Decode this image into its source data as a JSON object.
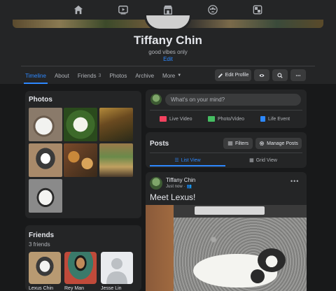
{
  "topnav": {
    "icons": [
      "home-icon",
      "watch-icon",
      "marketplace-icon",
      "groups-icon",
      "gaming-icon"
    ]
  },
  "profile": {
    "name": "Tiffany Chin",
    "bio": "good vibes only",
    "edit_link": "Edit"
  },
  "tabs": [
    {
      "label": "Timeline"
    },
    {
      "label": "About"
    },
    {
      "label": "Friends",
      "count": "3"
    },
    {
      "label": "Photos"
    },
    {
      "label": "Archive"
    },
    {
      "label": "More"
    }
  ],
  "header_buttons": {
    "edit_profile": "Edit Profile"
  },
  "photos_card": {
    "title": "Photos"
  },
  "friends_card": {
    "title": "Friends",
    "subtitle": "3 friends",
    "friends": [
      {
        "name": "Lexus Chin"
      },
      {
        "name": "Rey Man"
      },
      {
        "name": "Jesse Lin"
      }
    ]
  },
  "composer": {
    "placeholder": "What's on your mind?",
    "actions": [
      {
        "label": "Live Video",
        "color": "#f3425f"
      },
      {
        "label": "Photo/Video",
        "color": "#45bd62"
      },
      {
        "label": "Life Event",
        "color": "#2d88ff"
      }
    ]
  },
  "posts": {
    "title": "Posts",
    "filters_label": "Filters",
    "manage_label": "Manage Posts",
    "list_view_label": "List View",
    "grid_view_label": "Grid View"
  },
  "post": {
    "author": "Tiffany Chin",
    "time": "Just now",
    "text": "Meet Lexus!"
  },
  "colors": {
    "accent": "#2d88ff",
    "background": "#18191a",
    "card": "#242526"
  }
}
